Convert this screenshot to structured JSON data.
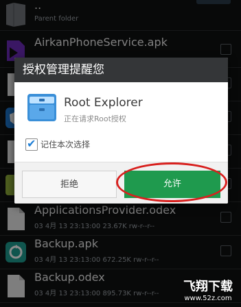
{
  "file_list": {
    "rows": [
      {
        "name": "..",
        "meta": "Parent folder",
        "icon": "folder-icon"
      },
      {
        "name": "AirkanPhoneService.apk",
        "meta": "",
        "icon": "apk-icon"
      },
      {
        "name": "",
        "meta": "",
        "icon": "file-icon"
      },
      {
        "name": "",
        "meta": "",
        "icon": "shield-app-icon"
      },
      {
        "name": "",
        "meta": "",
        "icon": "file-icon"
      },
      {
        "name": "",
        "meta": "",
        "icon": "android-app-icon"
      },
      {
        "name": "ApplicationsProvider.odex",
        "meta": "03 4月 13 23:13:00  23.67K  rw-r--r--",
        "icon": "file-icon"
      },
      {
        "name": "Backup.apk",
        "meta": "03 4月 13 23:13:00  672.25K  rw-r--r--",
        "icon": "backup-app-icon"
      },
      {
        "name": "Backup.odex",
        "meta": "03 4月 13 23:13:00  895.73K  rw-r--r--",
        "icon": "file-icon"
      }
    ]
  },
  "dialog": {
    "title": "授权管理提醒您",
    "app_name": "Root Explorer",
    "app_subtitle": "正在请求Root授权",
    "remember_label": "记住本次选择",
    "remember_checked": true,
    "deny_label": "拒绝",
    "allow_label": "允许",
    "allow_color": "#1f9a4e",
    "annotation_color": "#d8201e"
  },
  "watermark": {
    "line1": "飞翔下载",
    "line2": "www.52z.com"
  }
}
